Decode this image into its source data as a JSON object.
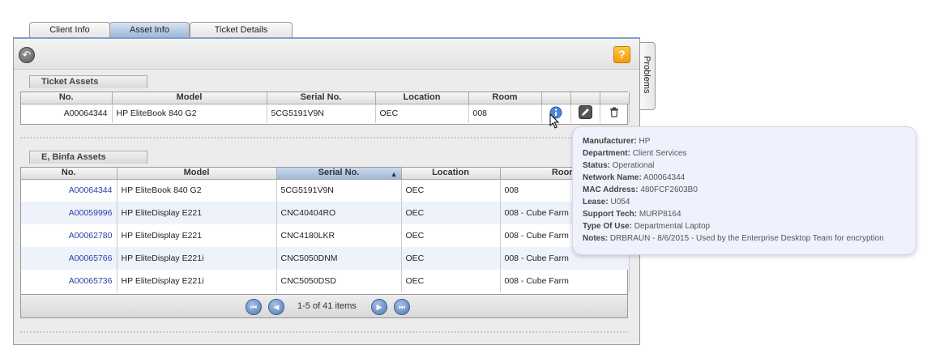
{
  "tabs": [
    {
      "label": "Client Info",
      "active": false
    },
    {
      "label": "Asset Info",
      "active": true
    },
    {
      "label": "Ticket Details",
      "active": false
    }
  ],
  "side_tab": {
    "label": "Problems"
  },
  "toolbar": {
    "help_label": "?"
  },
  "ticket_assets": {
    "title": "Ticket Assets",
    "columns": [
      "No.",
      "Model",
      "Serial No.",
      "Location",
      "Room"
    ],
    "rows": [
      {
        "no": "A00064344",
        "model": "HP EliteBook 840 G2",
        "serial": "5CG5191V9N",
        "location": "OEC",
        "room": "008"
      }
    ]
  },
  "user_assets": {
    "title": "E, Binfa Assets",
    "columns": [
      "No.",
      "Model",
      "Serial No.",
      "Location",
      "Room"
    ],
    "sorted_column": "Serial No.",
    "rows": [
      {
        "no": "A00064344",
        "model": "HP EliteBook 840 G2",
        "serial": "5CG5191V9N",
        "location": "OEC",
        "room": "008"
      },
      {
        "no": "A00059996",
        "model": "HP EliteDisplay E221",
        "serial": "CNC40404RO",
        "location": "OEC",
        "room": "008 - Cube Farm"
      },
      {
        "no": "A00062780",
        "model": "HP EliteDisplay E221",
        "serial": "CNC4180LKR",
        "location": "OEC",
        "room": "008 - Cube Farm"
      },
      {
        "no": "A00065766",
        "model": "HP EliteDisplay E221i",
        "serial": "CNC5050DNM",
        "location": "OEC",
        "room": "008 - Cube Farm"
      },
      {
        "no": "A00065736",
        "model": "HP EliteDisplay E221i",
        "serial": "CNC5050DSD",
        "location": "OEC",
        "room": "008 - Cube Farm"
      }
    ]
  },
  "pager": {
    "text": "1-5 of 41 items"
  },
  "tooltip": {
    "fields": [
      {
        "label": "Manufacturer:",
        "value": "HP"
      },
      {
        "label": "Department:",
        "value": "Client Services"
      },
      {
        "label": "Status:",
        "value": "Operational"
      },
      {
        "label": "Network Name:",
        "value": "A00064344"
      },
      {
        "label": "MAC Address:",
        "value": "480FCF2603B0"
      },
      {
        "label": "Lease:",
        "value": "U054"
      },
      {
        "label": "Support Tech:",
        "value": "MURP8164"
      },
      {
        "label": "Type Of Use:",
        "value": "Departmental Laptop"
      },
      {
        "label": "Notes:",
        "value": "DRBRAUN - 8/6/2015 - Used by the Enterprise Desktop Team for encryption"
      }
    ]
  },
  "colors": {
    "accent": "#7f9fc8",
    "link": "#2a3fa8",
    "help": "#f59a0c"
  }
}
